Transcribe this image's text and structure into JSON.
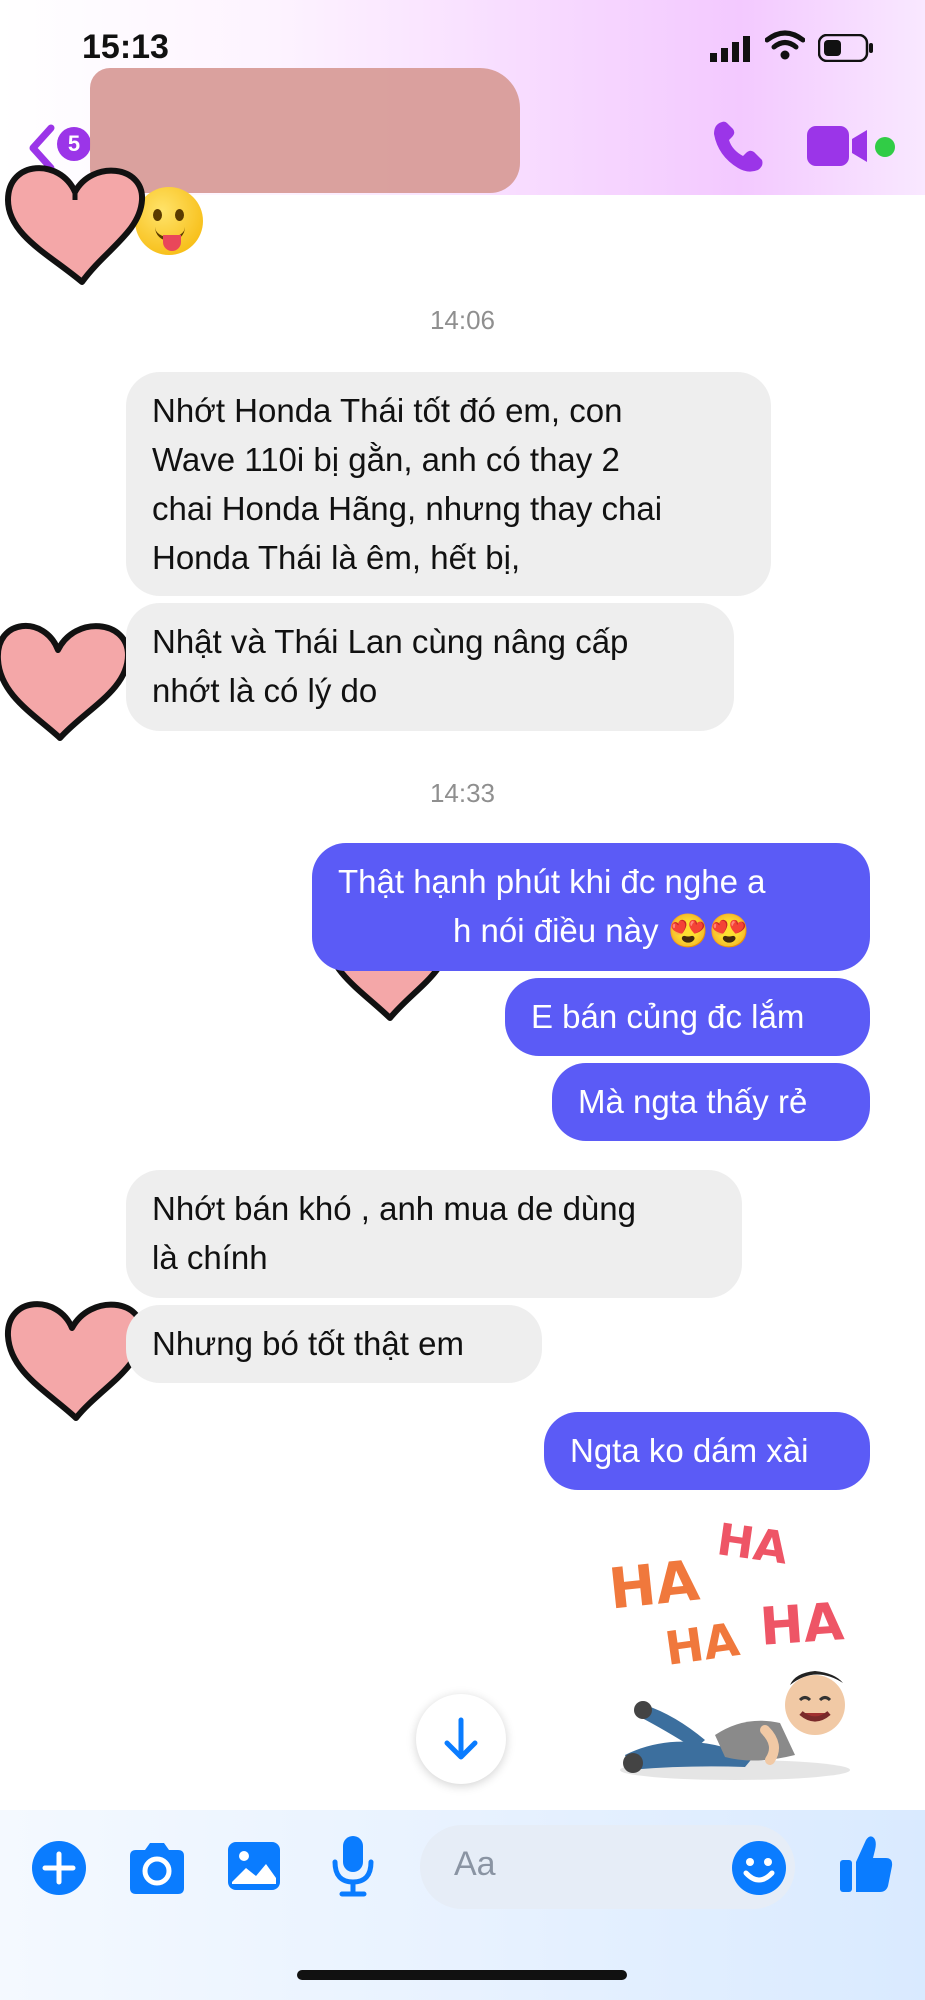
{
  "status_bar": {
    "time": "15:13"
  },
  "header": {
    "back_badge_count": "5"
  },
  "timestamps": [
    "14:06",
    "14:33"
  ],
  "messages": [
    {
      "direction": "in",
      "lines": [
        "Nhớt Honda Thái tốt đó em, con",
        "Wave 110i bị gằn, anh có thay 2",
        "chai Honda Hãng, nhưng thay chai",
        "Honda Thái là êm, hết bị,"
      ]
    },
    {
      "direction": "in",
      "lines": [
        "Nhật và Thái Lan cùng nâng cấp",
        "nhớt là có lý do"
      ]
    },
    {
      "direction": "out",
      "lines": [
        "Thật hạnh phút khi đc nghe a",
        "h nói điều này 😍😍"
      ]
    },
    {
      "direction": "out",
      "lines": [
        "E bán củng đc lắm"
      ]
    },
    {
      "direction": "out",
      "lines": [
        "Mà ngta thấy rẻ"
      ]
    },
    {
      "direction": "in",
      "lines": [
        "Nhớt bán khó , anh mua de dùng",
        "là chính"
      ]
    },
    {
      "direction": "in",
      "lines": [
        "Nhưng bó tốt thật em"
      ]
    },
    {
      "direction": "out",
      "lines": [
        "Ngta ko dám xài"
      ]
    }
  ],
  "sticker": {
    "texts": [
      "HA",
      "HA",
      "HA",
      "HA"
    ]
  },
  "composer": {
    "placeholder": "Aa"
  },
  "colors": {
    "outgoing_bubble": "#5b5bf6",
    "incoming_bubble": "#eeeeee",
    "accent": "#0a7cff",
    "header_accent": "#9b35e8"
  },
  "icons": [
    "back-chevron-icon",
    "phone-icon",
    "video-camera-icon",
    "plus-icon",
    "camera-icon",
    "image-icon",
    "microphone-icon",
    "emoji-icon",
    "thumbs-up-icon",
    "scroll-down-arrow-icon"
  ]
}
